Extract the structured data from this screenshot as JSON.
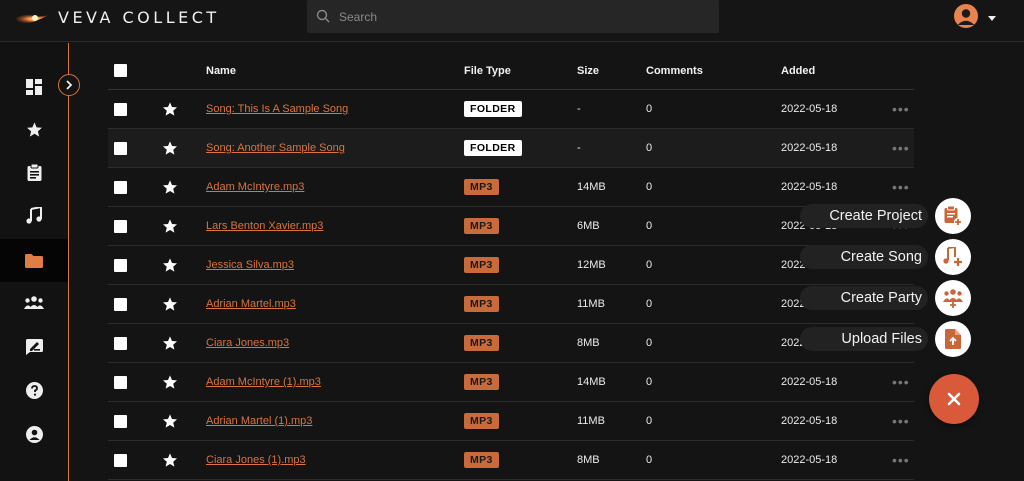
{
  "app": {
    "brand": "VEVA COLLECT"
  },
  "search": {
    "placeholder": "Search"
  },
  "colors": {
    "accent": "#d9743e",
    "fab_close": "#d9593b",
    "mp3_badge": "#c96a3a"
  },
  "sidebar": {
    "items": [
      {
        "name": "dashboard",
        "icon": "dashboard-icon"
      },
      {
        "name": "favorites",
        "icon": "star-icon"
      },
      {
        "name": "projects",
        "icon": "clipboard-icon"
      },
      {
        "name": "songs",
        "icon": "music-note-icon"
      },
      {
        "name": "files",
        "icon": "folder-icon",
        "active": true
      },
      {
        "name": "parties",
        "icon": "group-icon"
      },
      {
        "name": "feedback",
        "icon": "feedback-icon"
      },
      {
        "name": "help",
        "icon": "help-icon"
      },
      {
        "name": "account",
        "icon": "user-icon"
      }
    ]
  },
  "table": {
    "headers": {
      "name": "Name",
      "file_type": "File Type",
      "size": "Size",
      "comments": "Comments",
      "added": "Added"
    },
    "rows": [
      {
        "name": "Song: This Is A Sample Song",
        "type": "FOLDER",
        "size": "-",
        "comments": "0",
        "added": "2022-05-18"
      },
      {
        "name": "Song: Another Sample Song",
        "type": "FOLDER",
        "size": "-",
        "comments": "0",
        "added": "2022-05-18"
      },
      {
        "name": "Adam McIntyre.mp3",
        "type": "MP3",
        "size": "14MB",
        "comments": "0",
        "added": "2022-05-18"
      },
      {
        "name": "Lars Benton Xavier.mp3",
        "type": "MP3",
        "size": "6MB",
        "comments": "0",
        "added": "2022-05-18"
      },
      {
        "name": "Jessica Silva.mp3",
        "type": "MP3",
        "size": "12MB",
        "comments": "0",
        "added": "2022-05-18"
      },
      {
        "name": "Adrian Martel.mp3",
        "type": "MP3",
        "size": "11MB",
        "comments": "0",
        "added": "2022-05-18"
      },
      {
        "name": "Ciara Jones.mp3",
        "type": "MP3",
        "size": "8MB",
        "comments": "0",
        "added": "2022-05-18"
      },
      {
        "name": "Adam McIntyre (1).mp3",
        "type": "MP3",
        "size": "14MB",
        "comments": "0",
        "added": "2022-05-18"
      },
      {
        "name": "Adrian Martel (1).mp3",
        "type": "MP3",
        "size": "11MB",
        "comments": "0",
        "added": "2022-05-18"
      },
      {
        "name": "Ciara Jones (1).mp3",
        "type": "MP3",
        "size": "8MB",
        "comments": "0",
        "added": "2022-05-18"
      }
    ],
    "more_label": "•••"
  },
  "fab": {
    "actions": [
      {
        "label": "Create Project",
        "icon": "create-project-icon"
      },
      {
        "label": "Create Song",
        "icon": "create-song-icon"
      },
      {
        "label": "Create Party",
        "icon": "create-party-icon"
      },
      {
        "label": "Upload Files",
        "icon": "upload-file-icon"
      }
    ],
    "close_icon": "close-icon"
  }
}
